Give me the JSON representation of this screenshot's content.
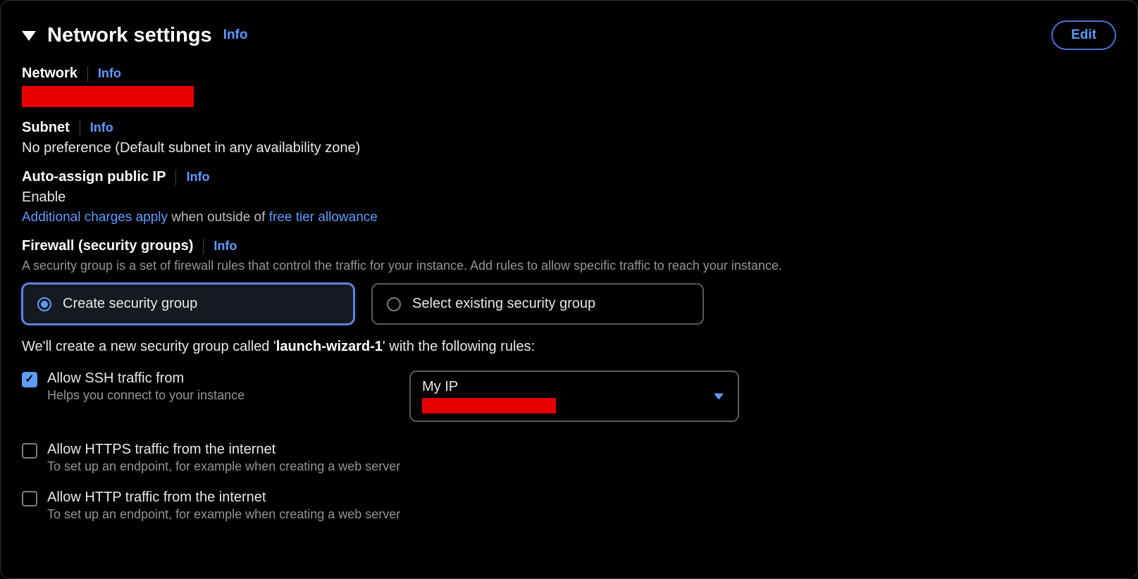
{
  "panel": {
    "title": "Network settings",
    "info": "Info",
    "edit": "Edit"
  },
  "network": {
    "label": "Network",
    "info": "Info"
  },
  "subnet": {
    "label": "Subnet",
    "info": "Info",
    "value": "No preference (Default subnet in any availability zone)"
  },
  "publicIp": {
    "label": "Auto-assign public IP",
    "info": "Info",
    "value": "Enable",
    "chargesLink": "Additional charges apply",
    "chargesMid": " when outside of ",
    "freeTierLink": "free tier allowance"
  },
  "firewall": {
    "label": "Firewall (security groups)",
    "info": "Info",
    "desc": "A security group is a set of firewall rules that control the traffic for your instance. Add rules to allow specific traffic to reach your instance.",
    "options": {
      "create": "Create security group",
      "select": "Select existing security group"
    },
    "notePrefix": "We'll create a new security group called '",
    "noteName": "launch-wizard-1",
    "noteSuffix": "' with the following rules:"
  },
  "rules": {
    "ssh": {
      "label": "Allow SSH traffic from",
      "desc": "Helps you connect to your instance",
      "selected": "My IP"
    },
    "https": {
      "label": "Allow HTTPS traffic from the internet",
      "desc": "To set up an endpoint, for example when creating a web server"
    },
    "http": {
      "label": "Allow HTTP traffic from the internet",
      "desc": "To set up an endpoint, for example when creating a web server"
    }
  }
}
